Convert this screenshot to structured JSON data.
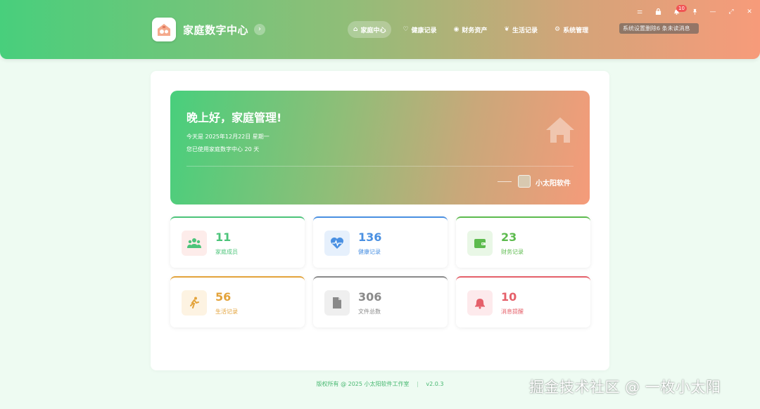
{
  "header": {
    "app_title": "家庭数字中心",
    "collapse_glyph": "›",
    "nav": [
      {
        "label": "家庭中心",
        "icon": "home-icon",
        "glyph": "⌂",
        "active": true
      },
      {
        "label": "健康记录",
        "icon": "heart-icon",
        "glyph": "♡",
        "active": false
      },
      {
        "label": "财务资产",
        "icon": "coins-icon",
        "glyph": "◉",
        "active": false
      },
      {
        "label": "生活记录",
        "icon": "leaf-icon",
        "glyph": "❦",
        "active": false
      },
      {
        "label": "系统管理",
        "icon": "cogs-icon",
        "glyph": "⚙",
        "active": false
      }
    ],
    "notice_text": "系统设置删除6 条未读消息",
    "window_controls": [
      {
        "name": "settings-icon",
        "glyph": "⚌"
      },
      {
        "name": "lock-icon",
        "glyph": "🔒"
      },
      {
        "name": "bell-icon",
        "glyph": "🔔",
        "badge": "10"
      },
      {
        "name": "pin-icon",
        "glyph": "📌"
      },
      {
        "name": "minimize-icon",
        "glyph": "—"
      },
      {
        "name": "maximize-icon",
        "glyph": "⤢"
      },
      {
        "name": "close-icon",
        "glyph": "✕"
      }
    ]
  },
  "welcome": {
    "greeting": "晚上好，家庭管理!",
    "date_line": "今天是 2025年12月22日 星期一",
    "days_line": "您已使用家庭数字中心 20 天",
    "signature": "小太阳软件"
  },
  "stats": [
    {
      "value": "11",
      "label": "家庭成员",
      "icon": "users-icon",
      "glyph": "👪",
      "color": "#4cc47a",
      "bg": "#fdecea"
    },
    {
      "value": "136",
      "label": "健康记录",
      "icon": "heartbeat-icon",
      "glyph": "♥",
      "color": "#4a90e2",
      "bg": "#e6f0fc"
    },
    {
      "value": "23",
      "label": "财务记录",
      "icon": "wallet-icon",
      "glyph": "▣",
      "color": "#5dbb4e",
      "bg": "#e9f7e6"
    },
    {
      "value": "56",
      "label": "生活记录",
      "icon": "running-icon",
      "glyph": "🏃",
      "color": "#e3a33b",
      "bg": "#fdf3e2"
    },
    {
      "value": "306",
      "label": "文件总数",
      "icon": "file-icon",
      "glyph": "▤",
      "color": "#8a8a8a",
      "bg": "#efefef"
    },
    {
      "value": "10",
      "label": "消息提醒",
      "icon": "bell-alert-icon",
      "glyph": "🔔",
      "color": "#e5606a",
      "bg": "#fdeaec"
    }
  ],
  "footer": {
    "copyright": "版权所有 @ 2025 小太阳软件工作室",
    "separator": "|",
    "version": "v2.0.3"
  },
  "watermark": "掘金技术社区 @ 一枚小太阳"
}
